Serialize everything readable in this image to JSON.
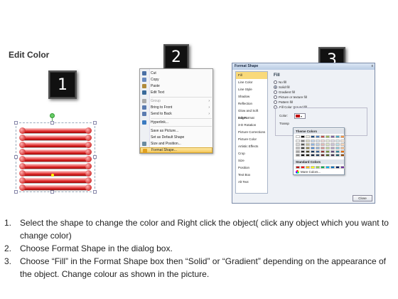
{
  "title": "Edit Color",
  "badges": [
    "1",
    "2",
    "3"
  ],
  "context_menu": {
    "items": [
      {
        "label": "Cut",
        "icon": "scissors-icon",
        "color": "#4a6fa5"
      },
      {
        "label": "Copy",
        "icon": "copy-icon",
        "color": "#6a8ac0"
      },
      {
        "label": "Paste",
        "icon": "paste-icon",
        "color": "#b08a3a"
      },
      {
        "label": "Edit Text",
        "icon": "edit-text-icon",
        "color": "#3a6a9a"
      },
      {
        "label": "Group",
        "icon": "group-icon",
        "color": "#aaaaaa",
        "dim": true,
        "submenu": true
      },
      {
        "label": "Bring to Front",
        "icon": "bring-front-icon",
        "color": "#5a7ab0",
        "submenu": true
      },
      {
        "label": "Send to Back",
        "icon": "send-back-icon",
        "color": "#5a7ab0",
        "submenu": true
      },
      {
        "label": "Hyperlink...",
        "icon": "hyperlink-icon",
        "color": "#3a7ac0"
      },
      {
        "label": "Save as Picture...",
        "icon": "",
        "color": ""
      },
      {
        "label": "Set as Default Shape",
        "icon": "",
        "color": ""
      },
      {
        "label": "Size and Position...",
        "icon": "size-position-icon",
        "color": "#6a8aa0"
      },
      {
        "label": "Format Shape...",
        "icon": "format-shape-icon",
        "color": "#e0a020",
        "highlight": true
      }
    ]
  },
  "dialog": {
    "title": "Format Shape",
    "close_x": "x",
    "categories": [
      "Fill",
      "Line Color",
      "Line Style",
      "Shadow",
      "Reflection",
      "Glow and Soft Edges",
      "3-D Format",
      "3-D Rotation",
      "Picture Corrections",
      "Picture Color",
      "Artistic Effects",
      "Crop",
      "Size",
      "Position",
      "Text Box",
      "Alt Text"
    ],
    "active_category": "Fill",
    "fill_heading": "Fill",
    "options": [
      "No fill",
      "Solid fill",
      "Gradient fill",
      "Picture or texture fill",
      "Pattern fill",
      "Slide background fill"
    ],
    "selected_option": "Solid fill",
    "fill_color_label": "Fill Color",
    "color_label": "Color:",
    "transparency_label": "Transp",
    "theme_colors_label": "Theme Colors",
    "standard_colors_label": "Standard Colors",
    "more_colors_label": "More Colors...",
    "close_button": "Close",
    "selected_color": "#c00000"
  },
  "palette": {
    "theme_top": [
      "#ffffff",
      "#000000",
      "#eeece1",
      "#1f497d",
      "#4f81bd",
      "#c0504d",
      "#9bbb59",
      "#8064a2",
      "#4bacc6",
      "#f79646"
    ],
    "theme_shades": [
      [
        "#f2f2f2",
        "#7f7f7f",
        "#ddd9c3",
        "#c6d9f0",
        "#dbe5f1",
        "#f2dcdb",
        "#ebf1dd",
        "#e5e0ec",
        "#dbeef3",
        "#fdeada"
      ],
      [
        "#d8d8d8",
        "#595959",
        "#c4bd97",
        "#8db3e2",
        "#b8cce4",
        "#e5b9b7",
        "#d7e3bc",
        "#ccc1d9",
        "#b7dde8",
        "#fbd5b5"
      ],
      [
        "#bfbfbf",
        "#3f3f3f",
        "#938953",
        "#548dd4",
        "#95b3d7",
        "#d99694",
        "#c3d69b",
        "#b2a2c7",
        "#92cddc",
        "#fac08f"
      ],
      [
        "#a5a5a5",
        "#262626",
        "#494429",
        "#17365d",
        "#366092",
        "#953734",
        "#76923c",
        "#5f497a",
        "#31859b",
        "#e36c09"
      ],
      [
        "#7f7f7f",
        "#0c0c0c",
        "#1d1b10",
        "#0f243e",
        "#244061",
        "#632423",
        "#4f6128",
        "#3f3151",
        "#205867",
        "#974806"
      ]
    ],
    "standard": [
      "#c00000",
      "#ff0000",
      "#ffc000",
      "#ffff00",
      "#92d050",
      "#00b050",
      "#00b0f0",
      "#0070c0",
      "#002060",
      "#7030a0"
    ]
  },
  "steps": [
    {
      "num": "1.",
      "text": "Select the shape to change the color and Right click the object( click any object which you want to change color)"
    },
    {
      "num": "2.",
      "text": "Choose Format Shape in the dialog box."
    },
    {
      "num": "3.",
      "text": "Choose “Fill” in the Format Shape box then “Solid” or “Gradient” depending on the appearance of the object. Change colour as shown in the picture."
    }
  ]
}
